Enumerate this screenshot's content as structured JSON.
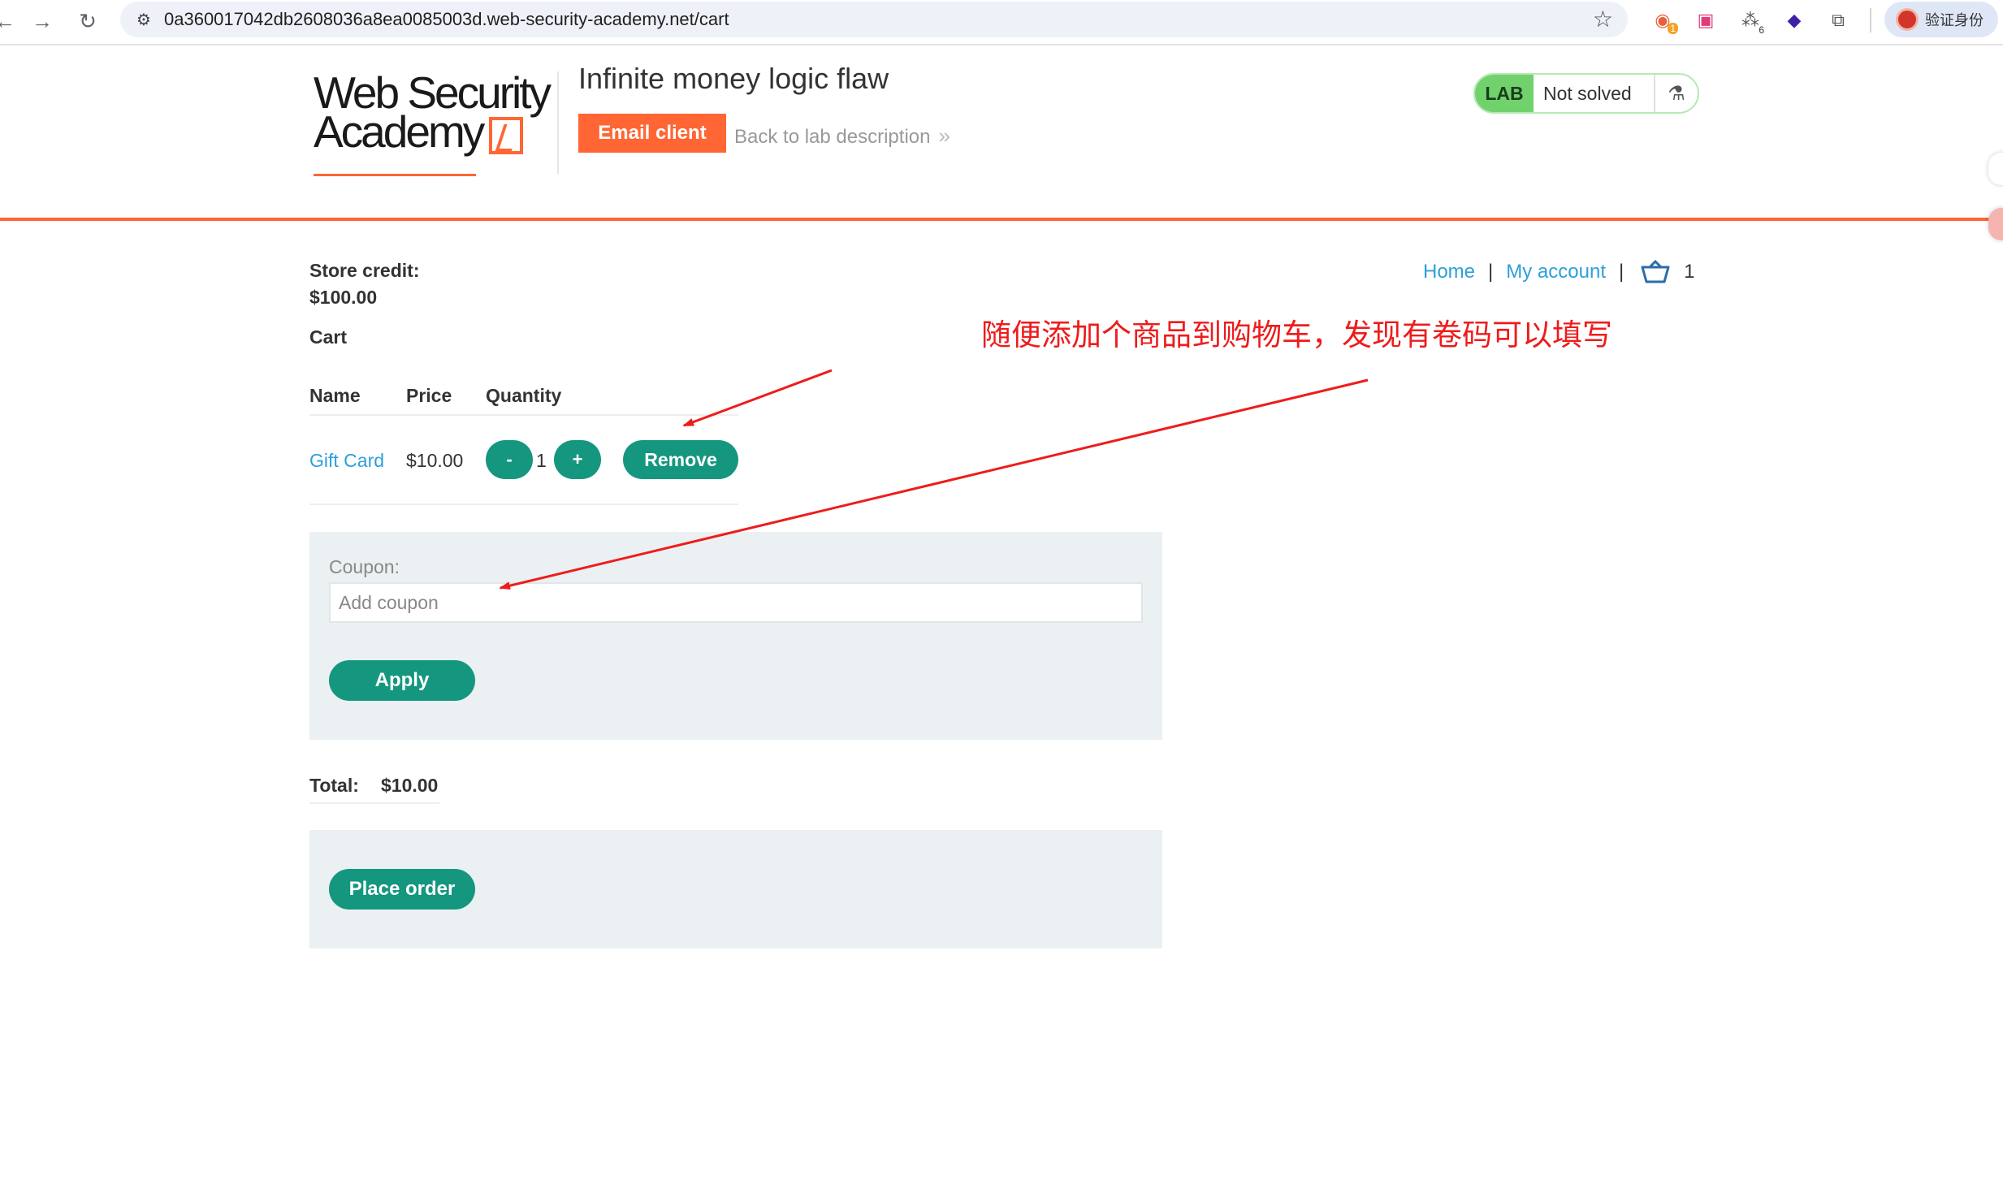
{
  "browser": {
    "url": "0a360017042db2608036a8ea0085003d.web-security-academy.net/cart",
    "back_icon": "arrow-left-icon",
    "forward_icon": "arrow-right-icon",
    "reload_icon": "reload-icon",
    "extension_badges": [
      "1",
      "6"
    ],
    "profile_label": "验证身份"
  },
  "header": {
    "logo_line1": "Web Security",
    "logo_line2": "Academy",
    "lab_title": "Infinite money logic flaw",
    "email_client_label": "Email client",
    "back_to_lab_label": "Back to lab description",
    "back_chevron": "»",
    "lab_tag": "LAB",
    "lab_status": "Not solved",
    "accent_color": "#ff6633"
  },
  "account": {
    "store_credit_label": "Store credit:",
    "store_credit_value": "$100.00",
    "nav_home": "Home",
    "nav_separator": "|",
    "nav_account": "My account",
    "cart_count": "1"
  },
  "cart": {
    "heading": "Cart",
    "columns": [
      "Name",
      "Price",
      "Quantity"
    ],
    "items": [
      {
        "name": "Gift Card",
        "price": "$10.00",
        "quantity": "1",
        "decrement": "-",
        "increment": "+",
        "remove": "Remove"
      }
    ]
  },
  "coupon": {
    "label": "Coupon:",
    "placeholder": "Add coupon",
    "apply_label": "Apply"
  },
  "totals": {
    "label": "Total:",
    "value": "$10.00"
  },
  "order": {
    "place_order_label": "Place order"
  },
  "annotation": {
    "text": "随便添加个商品到购物车，发现有卷码可以填写",
    "color": "#ee1c1c"
  }
}
